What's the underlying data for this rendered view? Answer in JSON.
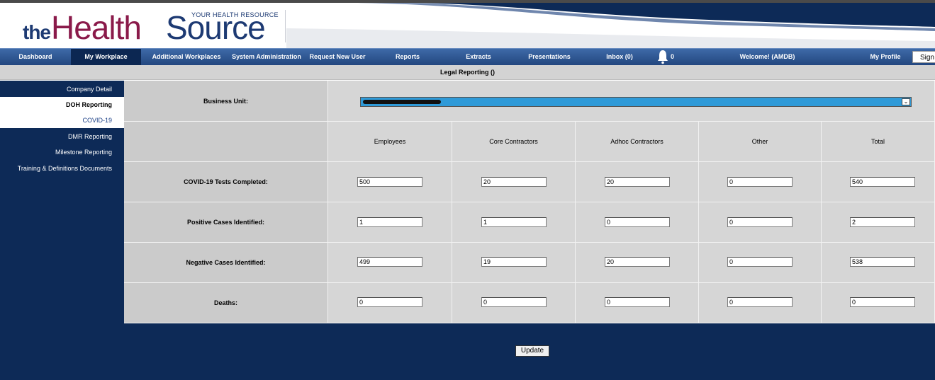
{
  "logo": {
    "prefix": "the",
    "word1": "Health",
    "word2": "Source",
    "tagline": "YOUR HEALTH RESOURCE"
  },
  "nav": {
    "items": [
      {
        "label": "Dashboard"
      },
      {
        "label": "My Workplace",
        "active": true
      },
      {
        "label": "Additional Workplaces"
      },
      {
        "label": "System Administration"
      },
      {
        "label": "Request New User"
      },
      {
        "label": "Reports"
      },
      {
        "label": "Extracts"
      },
      {
        "label": "Presentations"
      },
      {
        "label": "Inbox (0)"
      },
      {
        "label": "Welcome! (AMDB)"
      },
      {
        "label": "My Profile"
      }
    ],
    "bell_count": "0",
    "sign_label": "Sign"
  },
  "subheader": {
    "title": "Legal Reporting ()"
  },
  "sidebar": {
    "items": [
      {
        "label": "Company Detail"
      },
      {
        "label": "DOH Reporting",
        "selected": true
      },
      {
        "label": "COVID-19"
      },
      {
        "label": "DMR Reporting"
      },
      {
        "label": "Milestone Reporting"
      },
      {
        "label": "Training & Definitions Documents"
      }
    ]
  },
  "form": {
    "business_unit_label": "Business Unit:",
    "columns": [
      "Employees",
      "Core Contractors",
      "Adhoc Contractors",
      "Other",
      "Total"
    ],
    "rows": [
      {
        "label": "COVID-19 Tests Completed:",
        "values": [
          "500",
          "20",
          "20",
          "0",
          "540"
        ]
      },
      {
        "label": "Positive Cases Identified:",
        "values": [
          "1",
          "1",
          "0",
          "0",
          "2"
        ]
      },
      {
        "label": "Negative Cases Identified:",
        "values": [
          "499",
          "19",
          "20",
          "0",
          "538"
        ]
      },
      {
        "label": "Deaths:",
        "values": [
          "0",
          "0",
          "0",
          "0",
          "0"
        ]
      }
    ],
    "update_label": "Update"
  },
  "colors": {
    "navy": "#0d2a57",
    "nav_bar": "#2d5693",
    "logo_maroon": "#8a1a4a",
    "logo_blue": "#1d3a73",
    "select_blue": "#2f9ad8"
  }
}
